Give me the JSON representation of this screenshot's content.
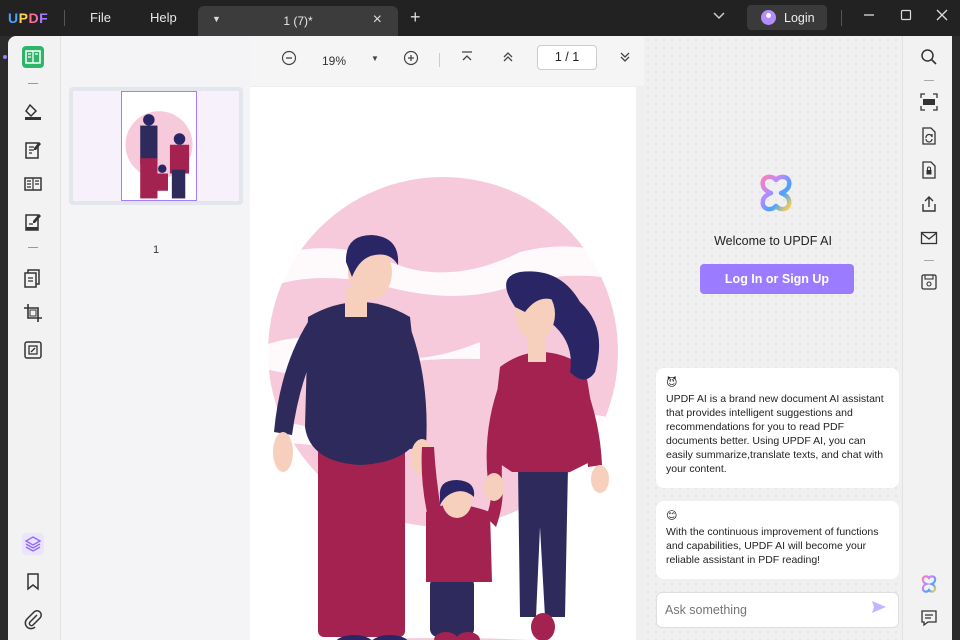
{
  "app": {
    "logo_text": "UPDF",
    "menu": [
      "File",
      "Help"
    ]
  },
  "tab": {
    "title": "1 (7)*",
    "dropdown_icon": "caret-down-icon",
    "close_icon": "close-icon"
  },
  "titlebar": {
    "login_label": "Login",
    "minimize_icon": "minimize-icon",
    "maximize_icon": "maximize-icon",
    "close_icon": "window-close-icon"
  },
  "toolbar": {
    "zoom": "19%",
    "current_page": "1",
    "page_separator": "/",
    "total_pages": "1"
  },
  "thumbnails": {
    "pages": [
      {
        "label": "1"
      }
    ]
  },
  "ai": {
    "welcome": "Welcome to UPDF AI",
    "signup_label": "Log In or Sign Up",
    "messages": [
      {
        "emoji": "😈",
        "text": "UPDF AI is a brand new document AI assistant that provides intelligent suggestions and recommendations for you to read PDF documents better. Using UPDF AI, you can easily summarize,translate texts, and chat with your content."
      },
      {
        "emoji": "😊",
        "text": "With the continuous improvement of functions and capabilities, UPDF AI will become your reliable assistant in PDF reading!"
      }
    ],
    "input_placeholder": "Ask something"
  },
  "colors": {
    "accent": "#9b7bff",
    "active_tool": "#2fb56a",
    "shirt": "#2e2a5c",
    "pants": "#a3224f",
    "skin": "#f6d0bc",
    "hair": "#2a2666",
    "blob": "#f6c9db"
  }
}
